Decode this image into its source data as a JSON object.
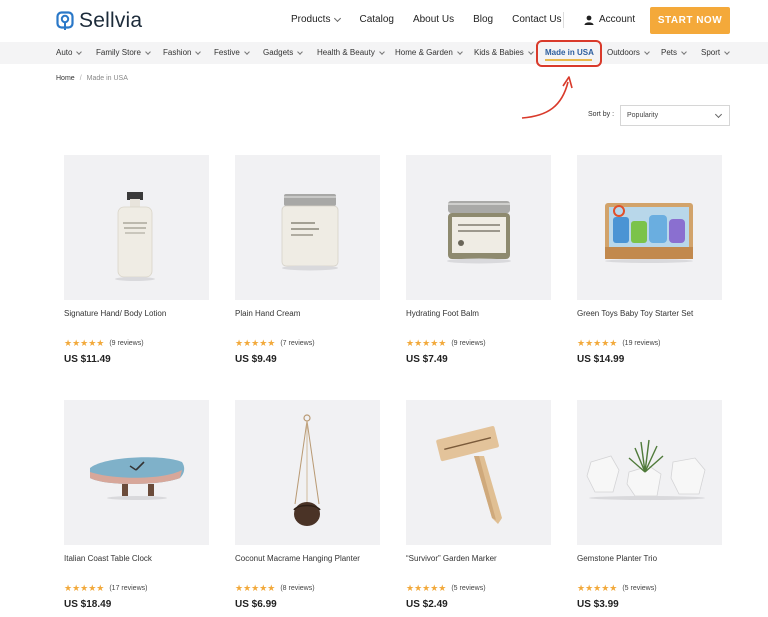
{
  "brand": {
    "name": "Sellvia"
  },
  "header": {
    "nav": [
      {
        "label": "Products",
        "dropdown": true
      },
      {
        "label": "Catalog"
      },
      {
        "label": "About Us"
      },
      {
        "label": "Blog"
      },
      {
        "label": "Contact Us"
      }
    ],
    "account_label": "Account",
    "cta_label": "START NOW",
    "cta_color": "#f4a93a"
  },
  "categories": [
    "Auto",
    "Family Store",
    "Fashion",
    "Festive",
    "Gadgets",
    "Health & Beauty",
    "Home & Garden",
    "Kids & Babies",
    "Made in USA",
    "Outdoors",
    "Pets",
    "Sport"
  ],
  "active_category": "Made in USA",
  "breadcrumb": {
    "home": "Home",
    "separator": "/",
    "current": "Made in USA"
  },
  "sort": {
    "label": "Sort by :",
    "value": "Popularity"
  },
  "stars": "★★★★★",
  "products": [
    {
      "name": "Signature Hand/ Body Lotion",
      "reviews": "(9 reviews)",
      "price": "US $11.49",
      "rating": 5
    },
    {
      "name": "Plain Hand Cream",
      "reviews": "(7 reviews)",
      "price": "US $9.49",
      "rating": 5
    },
    {
      "name": "Hydrating Foot Balm",
      "reviews": "(9 reviews)",
      "price": "US $7.49",
      "rating": 5
    },
    {
      "name": "Green Toys Baby Toy Starter Set",
      "reviews": "(19 reviews)",
      "price": "US $14.99",
      "rating": 5
    },
    {
      "name": "Italian Coast Table Clock",
      "reviews": "(17 reviews)",
      "price": "US $18.49",
      "rating": 5
    },
    {
      "name": "Coconut Macrame Hanging Planter",
      "reviews": "(8 reviews)",
      "price": "US $6.99",
      "rating": 5
    },
    {
      "name": "“Survivor” Garden Marker",
      "reviews": "(5 reviews)",
      "price": "US $2.49",
      "rating": 5
    },
    {
      "name": "Gemstone Planter Trio",
      "reviews": "(5 reviews)",
      "price": "US $3.99",
      "rating": 5
    }
  ],
  "colors": {
    "accent": "#f4a93a",
    "active_link": "#2c5e9e",
    "highlight": "#d93a2b",
    "star": "#f2a93b"
  }
}
